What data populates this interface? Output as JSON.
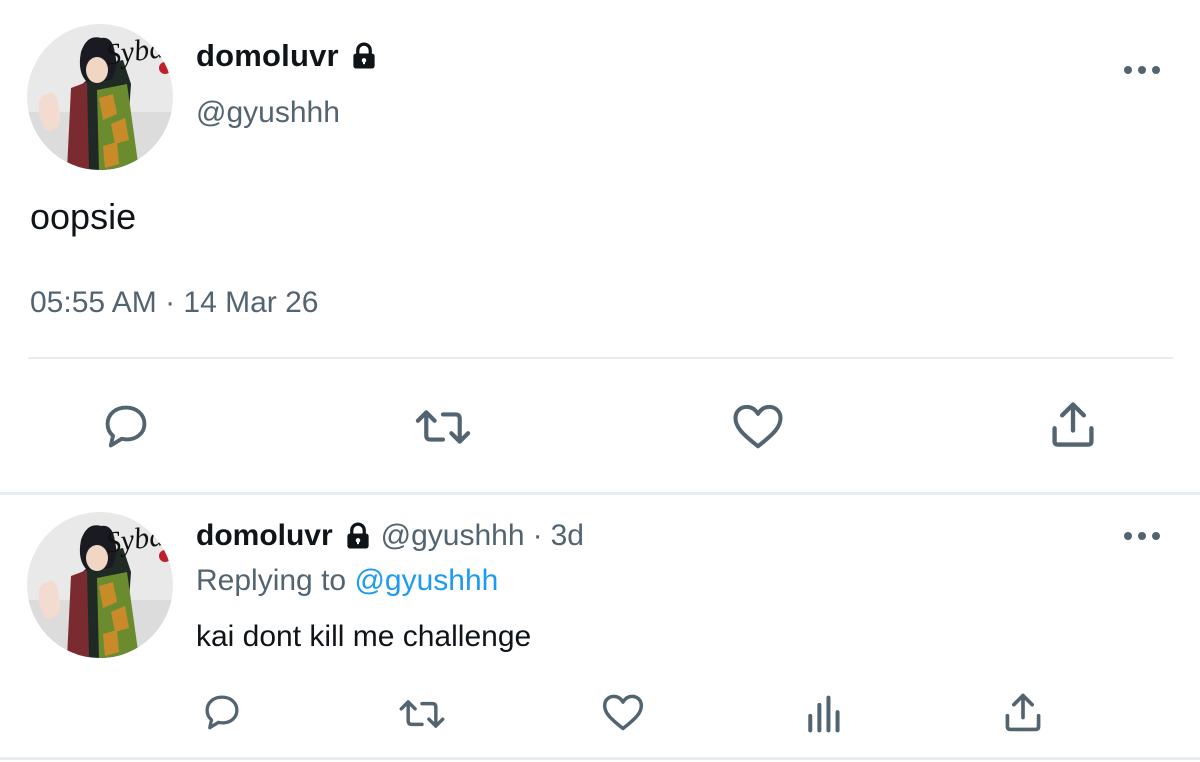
{
  "main_tweet": {
    "display_name": "domoluvr",
    "handle": "@gyushhh",
    "text": "oopsie",
    "timestamp": "05:55 AM · 14 Mar 26",
    "avatar_text": "Sybau",
    "icons": {
      "lock": "lock-icon",
      "more": "more-icon",
      "reply": "reply-icon",
      "retweet": "retweet-icon",
      "like": "heart-icon",
      "share": "share-icon"
    }
  },
  "reply_tweet": {
    "display_name": "domoluvr",
    "handle": "@gyushhh",
    "separator": "·",
    "age": "3d",
    "replying_prefix": "Replying to",
    "replying_handle": "@gyushhh",
    "text": "kai dont kill me challenge",
    "avatar_text": "Sybau",
    "icons": {
      "lock": "lock-icon",
      "more": "more-icon",
      "reply": "reply-icon",
      "retweet": "retweet-icon",
      "like": "heart-icon",
      "analytics": "analytics-icon",
      "share": "share-icon"
    }
  },
  "colors": {
    "text": "#0f1419",
    "secondary": "#536471",
    "link": "#1d9bf0",
    "divider": "#e6ecf0"
  }
}
